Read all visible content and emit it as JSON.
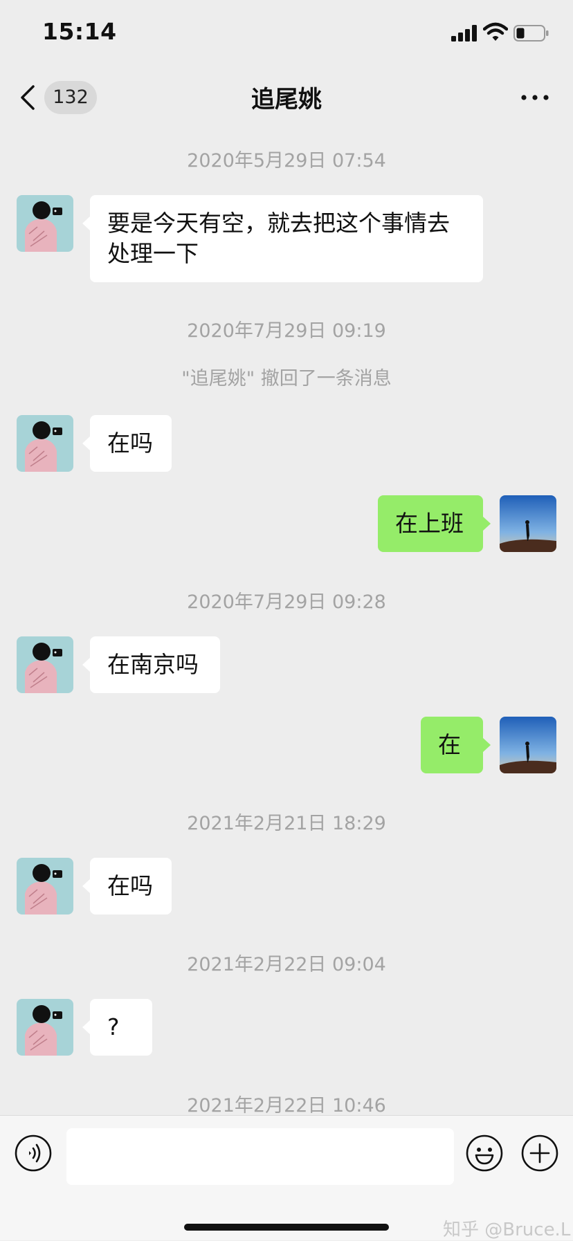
{
  "status_bar": {
    "time": "15:14"
  },
  "nav": {
    "back_badge": "132",
    "title": "追尾姚"
  },
  "messages": [
    {
      "kind": "timestamp",
      "text": "2020年5月29日 07:54"
    },
    {
      "kind": "incoming",
      "text": "要是今天有空，就去把这个事情去\n处理一下"
    },
    {
      "kind": "timestamp",
      "text": "2020年7月29日 09:19"
    },
    {
      "kind": "system",
      "text": "\"追尾姚\" 撤回了一条消息"
    },
    {
      "kind": "incoming",
      "text": "在吗"
    },
    {
      "kind": "outgoing",
      "text": "在上班"
    },
    {
      "kind": "timestamp",
      "text": "2020年7月29日 09:28"
    },
    {
      "kind": "incoming",
      "text": "在南京吗"
    },
    {
      "kind": "outgoing",
      "text": "在"
    },
    {
      "kind": "timestamp",
      "text": "2021年2月21日 18:29"
    },
    {
      "kind": "incoming",
      "text": "在吗"
    },
    {
      "kind": "timestamp",
      "text": "2021年2月22日 09:04"
    },
    {
      "kind": "incoming",
      "text": "?"
    },
    {
      "kind": "timestamp",
      "text": "2021年2月22日 10:46"
    }
  ],
  "input_bar": {
    "placeholder": "",
    "watermark": "知乎 @Bruce.L"
  },
  "icons": {
    "back": "chevron-left-icon",
    "more": "more-dots-icon",
    "voice": "voice-icon",
    "emoji": "emoji-icon",
    "plus": "plus-icon",
    "signal": "signal-icon",
    "wifi": "wifi-icon",
    "battery": "battery-icon"
  },
  "colors": {
    "background": "#ededed",
    "incoming_bubble": "#ffffff",
    "outgoing_bubble": "#95ec69",
    "timestamp": "#a3a3a3"
  }
}
